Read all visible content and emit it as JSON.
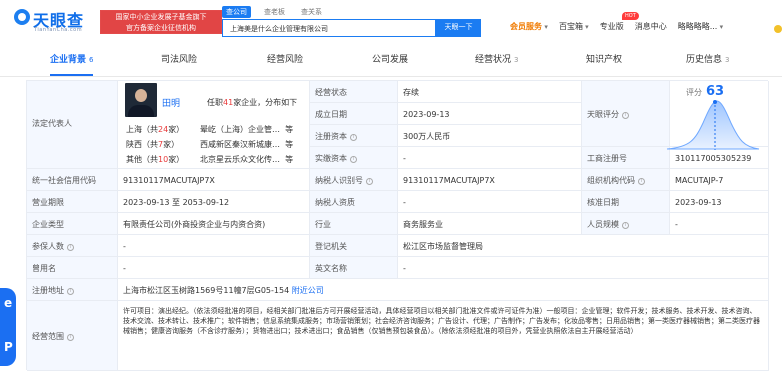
{
  "header": {
    "logo_text": "天眼查",
    "logo_sub": "TianYanCha.com",
    "fund_badge_line1": "国家中小企业发展子基金旗下",
    "fund_badge_line2": "官方备案企业征信机构",
    "search_tabs": [
      "查公司",
      "查老板",
      "查关系"
    ],
    "search_value": "上海美是什么企业管理有限公司",
    "search_button": "天眼一下",
    "nav": [
      "会员服务",
      "百宝箱",
      "专业版",
      "消息中心",
      "略略略略..."
    ],
    "hot_badge": "HOT"
  },
  "tabs": [
    {
      "label": "企业背景",
      "count": "6"
    },
    {
      "label": "司法风险",
      "count": ""
    },
    {
      "label": "经营风险",
      "count": ""
    },
    {
      "label": "公司发展",
      "count": ""
    },
    {
      "label": "经营状况",
      "count": "3"
    },
    {
      "label": "知识产权",
      "count": ""
    },
    {
      "label": "历史信息",
      "count": "3"
    }
  ],
  "legal": {
    "label": "法定代表人",
    "name": "田明",
    "post_prefix": "任职",
    "post_count": "41",
    "post_suffix": "家企业，分布如下",
    "regions": [
      {
        "name": "上海",
        "count": "24",
        "company": "晕屹（上海）企业管…",
        "more": "等"
      },
      {
        "name": "陕西",
        "count": "7",
        "company": "西咸新区秦汉新城康…",
        "more": "等"
      },
      {
        "name": "其他",
        "count": "10",
        "company": "北京星云乐众文化传…",
        "more": "等"
      }
    ]
  },
  "rows": {
    "status_label": "经营状态",
    "status": "存续",
    "found_label": "成立日期",
    "found": "2023-09-13",
    "capital_label": "注册资本",
    "capital": "300万人民币",
    "paid_label": "实缴资本",
    "paid": "-",
    "score_label": "天眼评分",
    "score_title": "评分",
    "score": "63",
    "reg_label": "工商注册号",
    "reg": "310117005305239",
    "credit_label": "统一社会信用代码",
    "credit": "91310117MACUTAJP7X",
    "tax_label": "纳税人识别号",
    "tax": "91310117MACUTAJP7X",
    "org_label": "组织机构代码",
    "org": "MACUTAJP-7",
    "term_label": "营业期限",
    "term": "2023-09-13 至 2053-09-12",
    "taxpayer_label": "纳税人资质",
    "taxpayer": "-",
    "approve_label": "核准日期",
    "approve": "2023-09-13",
    "type_label": "企业类型",
    "type": "有限责任公司(外商投资企业与内资合资)",
    "industry_label": "行业",
    "industry": "商务服务业",
    "size_label": "人员规模",
    "size": "-",
    "insured_label": "参保人数",
    "insured": "-",
    "authority_label": "登记机关",
    "authority": "松江区市场监督管理局",
    "former_label": "曾用名",
    "former": "-",
    "english_label": "英文名称",
    "english": "-",
    "address_label": "注册地址",
    "address": "上海市松江区玉树路1569号11幢7层G05-154",
    "address_link": "附近公司",
    "scope_label": "经营范围",
    "scope": "许可项目：演出经纪。（依法须经批准的项目，经相关部门批准后方可开展经营活动，具体经营项目以相关部门批准文件或许可证件为准）一般项目：企业管理；软件开发；技术服务、技术开发、技术咨询、技术交流、技术转让、技术推广；软件销售；信息系统集成服务；市场营销策划；社会经济咨询服务；广告设计、代理；广告制作；广告发布；化妆品零售；日用品销售；第一类医疗器械销售；第二类医疗器械销售；健康咨询服务（不含诊疗服务）；货物进出口；技术进出口；食品销售（仅销售预包装食品）。（除依法须经批准的项目外，凭营业执照依法自主开展经营活动）"
  },
  "side_float": {
    "top": "e",
    "bottom": "P"
  },
  "colors": {
    "accent": "#1b6ff2",
    "label_bg": "#f4f8ff",
    "warning": "#e14545"
  }
}
